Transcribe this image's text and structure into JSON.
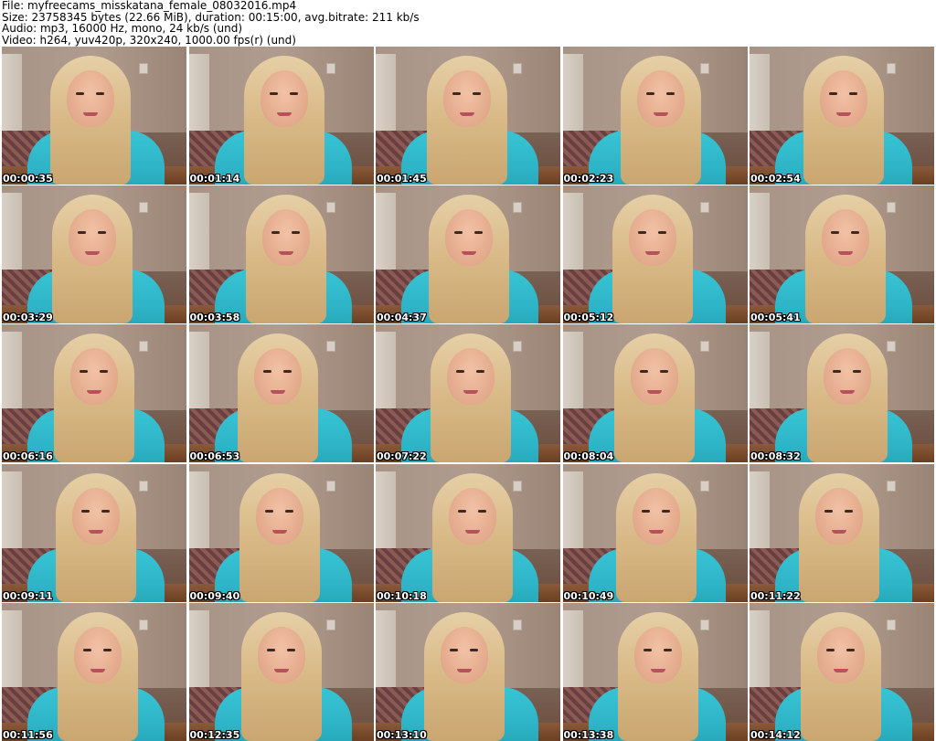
{
  "header": {
    "file": "File: myfreecams_misskatana_female_08032016.mp4",
    "size": "Size: 23758345 bytes (22.66 MiB), duration: 00:15:00, avg.bitrate: 211 kb/s",
    "audio": "Audio: mp3, 16000 Hz, mono, 24 kb/s (und)",
    "video": "Video: h264, yuv420p, 320x240, 1000.00 fps(r) (und)"
  },
  "thumbnails": [
    {
      "timestamp": "00:00:35"
    },
    {
      "timestamp": "00:01:14"
    },
    {
      "timestamp": "00:01:45"
    },
    {
      "timestamp": "00:02:23"
    },
    {
      "timestamp": "00:02:54"
    },
    {
      "timestamp": "00:03:29"
    },
    {
      "timestamp": "00:03:58"
    },
    {
      "timestamp": "00:04:37"
    },
    {
      "timestamp": "00:05:12"
    },
    {
      "timestamp": "00:05:41"
    },
    {
      "timestamp": "00:06:16"
    },
    {
      "timestamp": "00:06:53"
    },
    {
      "timestamp": "00:07:22"
    },
    {
      "timestamp": "00:08:04"
    },
    {
      "timestamp": "00:08:32"
    },
    {
      "timestamp": "00:09:11"
    },
    {
      "timestamp": "00:09:40"
    },
    {
      "timestamp": "00:10:18"
    },
    {
      "timestamp": "00:10:49"
    },
    {
      "timestamp": "00:11:22"
    },
    {
      "timestamp": "00:11:56"
    },
    {
      "timestamp": "00:12:35"
    },
    {
      "timestamp": "00:13:10"
    },
    {
      "timestamp": "00:13:38"
    },
    {
      "timestamp": "00:14:12"
    }
  ],
  "colors": {
    "sweater": "#2db4c6",
    "hair": "#d8b986",
    "timestamp_text": "#ffffff"
  }
}
